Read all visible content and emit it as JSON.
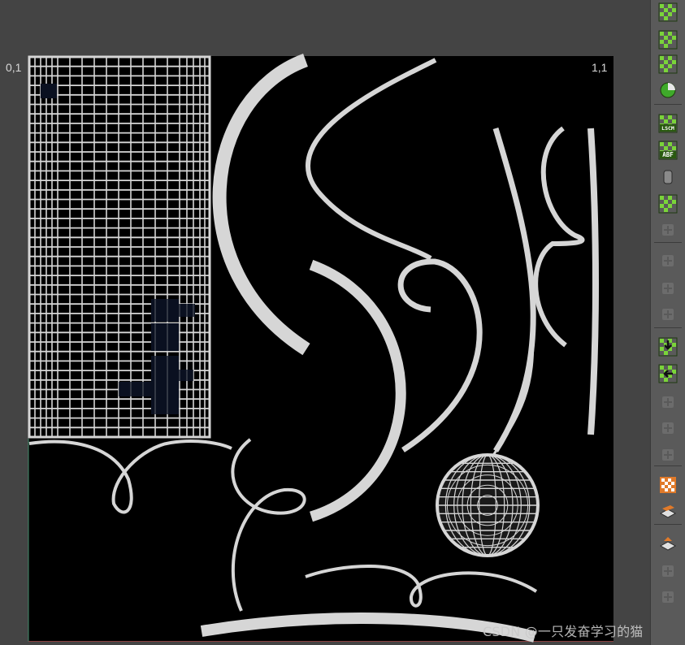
{
  "viewport": {
    "corner_top_left": "0,1",
    "corner_top_right": "1,1",
    "background": "#000000",
    "wire_color": "#d6d6d6"
  },
  "watermark": {
    "text": "CSDN @一只发奋学习的猫"
  },
  "toolbar": {
    "tools": [
      {
        "name": "checker-lock-icon",
        "enabled": true
      },
      {
        "name": "checker-x-icon",
        "enabled": true
      },
      {
        "name": "checker-plus-icon",
        "enabled": true
      },
      {
        "name": "sphere-shade-icon",
        "enabled": true
      },
      {
        "name": "lscm-unwrap-icon",
        "label": "LSCM",
        "enabled": true
      },
      {
        "name": "abf-unwrap-icon",
        "label": "ABF",
        "enabled": true
      },
      {
        "name": "cylinder-icon",
        "enabled": true
      },
      {
        "name": "pack-islands-icon",
        "enabled": true
      },
      {
        "name": "disabled-tool-icon",
        "enabled": false
      },
      {
        "name": "disabled-edit-icon",
        "enabled": false
      },
      {
        "name": "disabled-edit-2-icon",
        "enabled": false
      },
      {
        "name": "disabled-edit-3-icon",
        "enabled": false
      },
      {
        "name": "align-down-icon",
        "enabled": true
      },
      {
        "name": "align-left-icon",
        "enabled": true
      },
      {
        "name": "disabled-align-icon",
        "enabled": false
      },
      {
        "name": "disabled-align-2-icon",
        "enabled": false
      },
      {
        "name": "disabled-grid-icon",
        "enabled": false
      },
      {
        "name": "checker-texture-icon",
        "enabled": true
      },
      {
        "name": "layers-icon",
        "enabled": true
      },
      {
        "name": "stack-up-icon",
        "enabled": true
      },
      {
        "name": "disabled-stack-icon",
        "enabled": false
      },
      {
        "name": "disabled-stack-2-icon",
        "enabled": false
      }
    ]
  }
}
